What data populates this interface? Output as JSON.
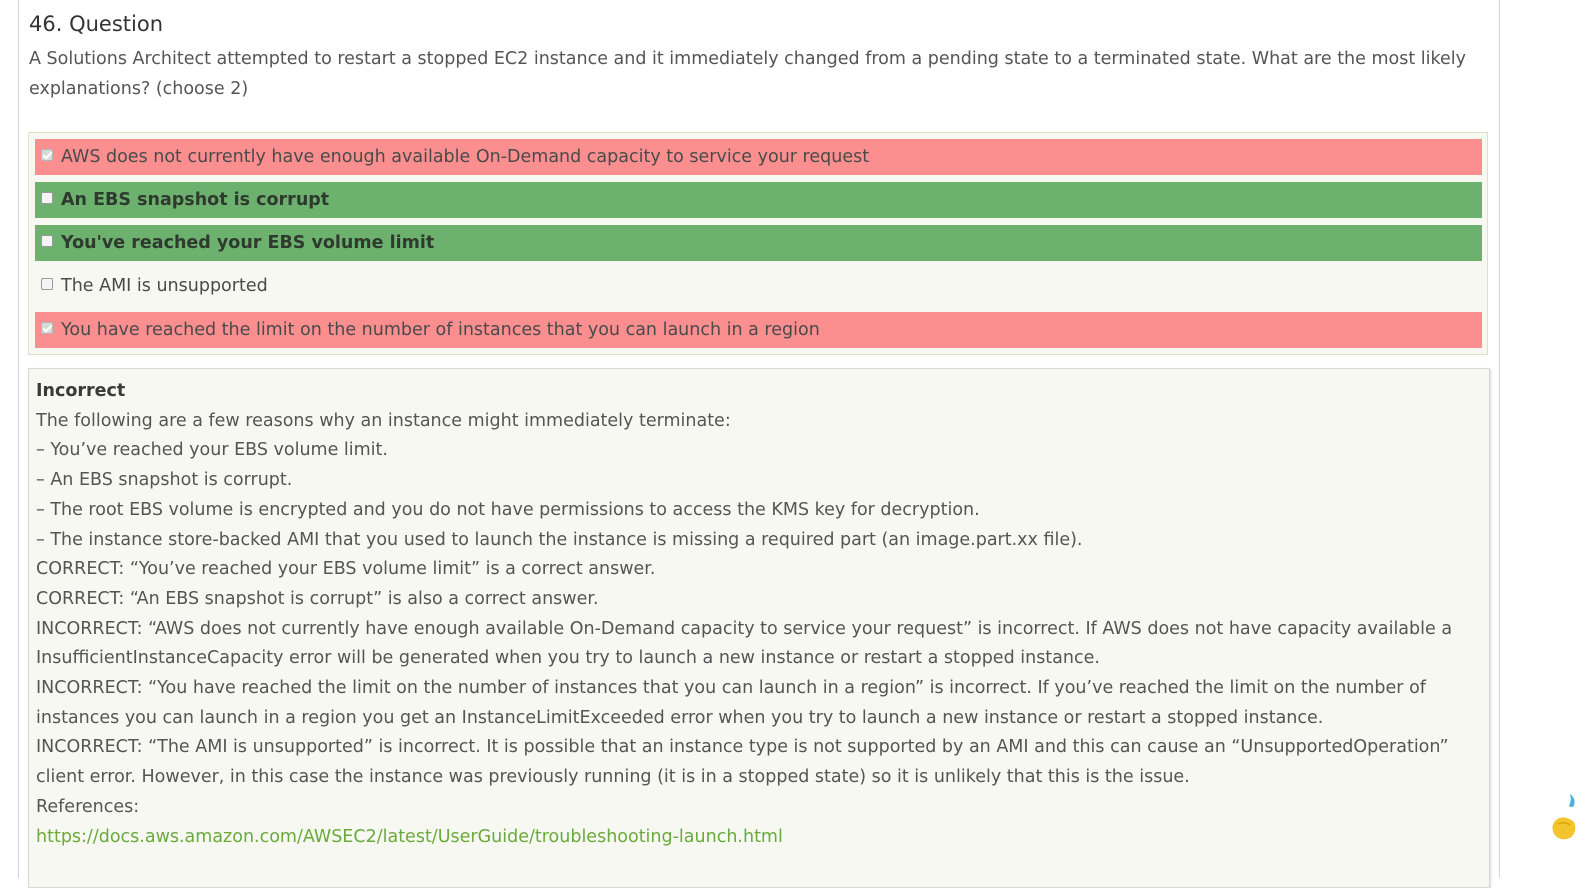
{
  "question": {
    "title": "46. Question",
    "text": "A Solutions Architect attempted to restart a stopped EC2 instance and it immediately changed from a pending state to a terminated state. What are the most likely explanations? (choose 2)"
  },
  "answers": [
    {
      "label": "AWS does not currently have enough available On-Demand capacity to service your request",
      "checked": true,
      "state": "wrong"
    },
    {
      "label": "An EBS snapshot is corrupt",
      "checked": false,
      "state": "correct"
    },
    {
      "label": "You've reached your EBS volume limit",
      "checked": false,
      "state": "correct"
    },
    {
      "label": "The AMI is unsupported",
      "checked": false,
      "state": "none"
    },
    {
      "label": "You have reached the limit on the number of instances that you can launch in a region",
      "checked": true,
      "state": "wrong"
    }
  ],
  "explanation": {
    "status": "Incorrect",
    "lines": [
      "The following are a few reasons why an instance might immediately terminate:",
      "– You’ve reached your EBS volume limit.",
      "– An EBS snapshot is corrupt.",
      "– The root EBS volume is encrypted and you do not have permissions to access the KMS key for decryption.",
      "– The instance store-backed AMI that you used to launch the instance is missing a required part (an image.part.xx file).",
      "CORRECT: “You’ve reached your EBS volume limit” is a correct answer.",
      "CORRECT: “An EBS snapshot is corrupt” is also a correct answer.",
      "INCORRECT: “AWS does not currently have enough available On-Demand capacity to service your request” is incorrect. If AWS does not have capacity available a InsufficientInstanceCapacity error will be generated when you try to launch a new instance or restart a stopped instance.",
      "INCORRECT: “You have reached the limit on the number of instances that you can launch in a region” is incorrect. If you’ve reached the limit on the number of instances you can launch in a region you get an InstanceLimitExceeded error when you try to launch a new instance or restart a stopped instance.",
      "INCORRECT: “The AMI is unsupported” is incorrect. It is possible that an instance type is not supported by an AMI and this can cause an “UnsupportedOperation” client error. However, in this case the instance was previously running (it is in a stopped state) so it is unlikely that this is the issue.",
      "References:"
    ],
    "reference_link": "https://docs.aws.amazon.com/AWSEC2/latest/UserGuide/troubleshooting-launch.html"
  },
  "colors": {
    "wrong": "#fb8f8f",
    "correct": "#6db16f",
    "link": "#6aaa3a"
  }
}
